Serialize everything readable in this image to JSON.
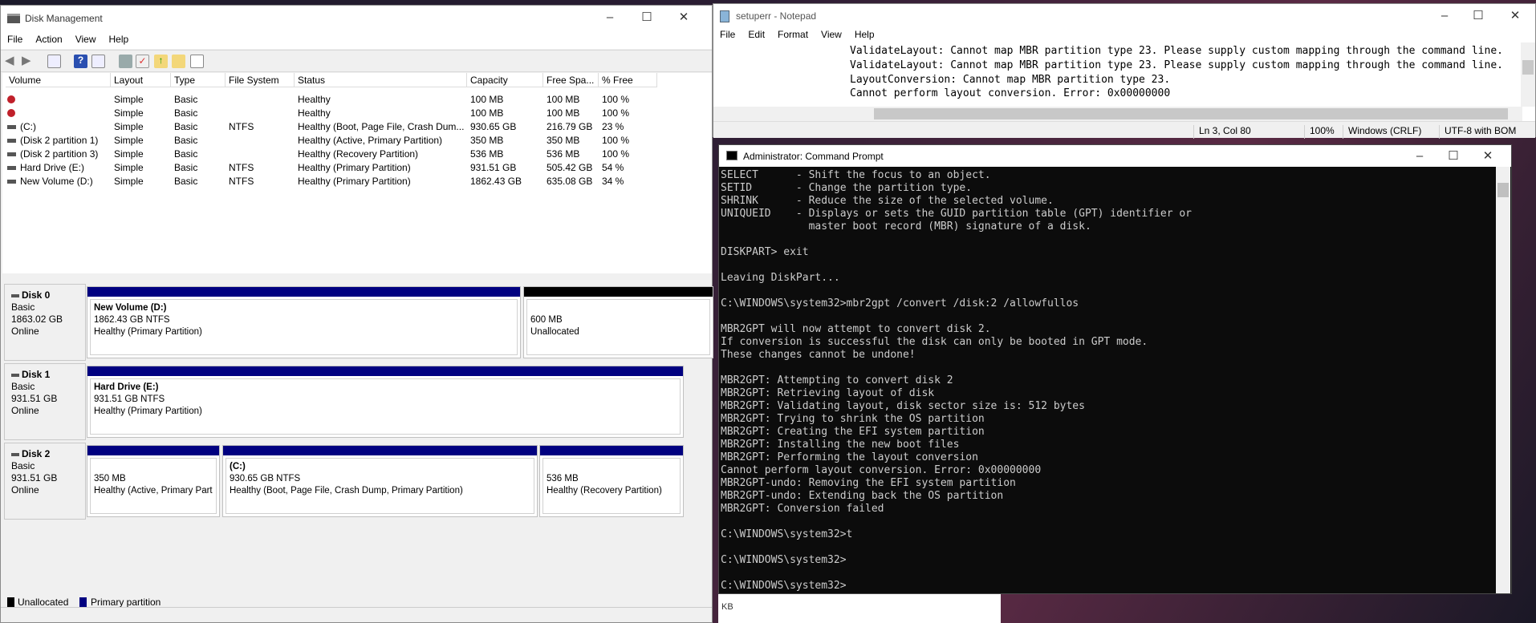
{
  "disk_mgmt": {
    "title": "Disk Management",
    "menu": [
      "File",
      "Action",
      "View",
      "Help"
    ],
    "columns": [
      "Volume",
      "Layout",
      "Type",
      "File System",
      "Status",
      "Capacity",
      "Free Spa...",
      "% Free"
    ],
    "rows": [
      {
        "icon": "error-volume-icon",
        "volume": "",
        "layout": "Simple",
        "type": "Basic",
        "fs": "",
        "status": "Healthy",
        "capacity": "100 MB",
        "free": "100 MB",
        "pct": "100 %"
      },
      {
        "icon": "error-volume-icon",
        "volume": "",
        "layout": "Simple",
        "type": "Basic",
        "fs": "",
        "status": "Healthy",
        "capacity": "100 MB",
        "free": "100 MB",
        "pct": "100 %"
      },
      {
        "icon": "drive-icon",
        "volume": "(C:)",
        "layout": "Simple",
        "type": "Basic",
        "fs": "NTFS",
        "status": "Healthy (Boot, Page File, Crash Dum...",
        "capacity": "930.65 GB",
        "free": "216.79 GB",
        "pct": "23 %"
      },
      {
        "icon": "drive-icon",
        "volume": "(Disk 2 partition 1)",
        "layout": "Simple",
        "type": "Basic",
        "fs": "",
        "status": "Healthy (Active, Primary Partition)",
        "capacity": "350 MB",
        "free": "350 MB",
        "pct": "100 %"
      },
      {
        "icon": "drive-icon",
        "volume": "(Disk 2 partition 3)",
        "layout": "Simple",
        "type": "Basic",
        "fs": "",
        "status": "Healthy (Recovery Partition)",
        "capacity": "536 MB",
        "free": "536 MB",
        "pct": "100 %"
      },
      {
        "icon": "drive-icon",
        "volume": "Hard Drive (E:)",
        "layout": "Simple",
        "type": "Basic",
        "fs": "NTFS",
        "status": "Healthy (Primary Partition)",
        "capacity": "931.51 GB",
        "free": "505.42 GB",
        "pct": "54 %"
      },
      {
        "icon": "drive-icon",
        "volume": "New Volume (D:)",
        "layout": "Simple",
        "type": "Basic",
        "fs": "NTFS",
        "status": "Healthy (Primary Partition)",
        "capacity": "1862.43 GB",
        "free": "635.08 GB",
        "pct": "34 %"
      }
    ],
    "disks": [
      {
        "name": "Disk 0",
        "type": "Basic",
        "size": "1863.02 GB",
        "state": "Online",
        "parts": [
          {
            "title": "New Volume  (D:)",
            "line1": "1862.43 GB NTFS",
            "line2": "Healthy (Primary Partition)"
          },
          {
            "title": "",
            "line1": "600 MB",
            "line2": "Unallocated"
          }
        ]
      },
      {
        "name": "Disk 1",
        "type": "Basic",
        "size": "931.51 GB",
        "state": "Online",
        "parts": [
          {
            "title": "Hard Drive  (E:)",
            "line1": "931.51 GB NTFS",
            "line2": "Healthy (Primary Partition)"
          }
        ]
      },
      {
        "name": "Disk 2",
        "type": "Basic",
        "size": "931.51 GB",
        "state": "Online",
        "parts": [
          {
            "title": "",
            "line1": "350 MB",
            "line2": "Healthy (Active, Primary Part"
          },
          {
            "title": "(C:)",
            "line1": "930.65 GB NTFS",
            "line2": "Healthy (Boot, Page File, Crash Dump, Primary Partition)"
          },
          {
            "title": "",
            "line1": "536 MB",
            "line2": "Healthy (Recovery Partition)"
          }
        ]
      }
    ],
    "legend": [
      "Unallocated",
      "Primary partition"
    ],
    "colors": {
      "primary": "#000080",
      "unallocated": "#000000"
    }
  },
  "notepad": {
    "title": "setuperr - Notepad",
    "menu": [
      "File",
      "Edit",
      "Format",
      "View",
      "Help"
    ],
    "lines": [
      "ValidateLayout: Cannot map MBR partition type 23. Please supply custom mapping through the command line.",
      "ValidateLayout: Cannot map MBR partition type 23. Please supply custom mapping through the command line.",
      "LayoutConversion: Cannot map MBR partition type 23.",
      "Cannot perform layout conversion. Error: 0x00000000"
    ],
    "status": {
      "position": "Ln 3, Col 80",
      "zoom": "100%",
      "eol": "Windows (CRLF)",
      "encoding": "UTF-8 with BOM"
    }
  },
  "cmd": {
    "title": "Administrator: Command Prompt",
    "lines": [
      "SELECT      - Shift the focus to an object.",
      "SETID       - Change the partition type.",
      "SHRINK      - Reduce the size of the selected volume.",
      "UNIQUEID    - Displays or sets the GUID partition table (GPT) identifier or",
      "              master boot record (MBR) signature of a disk.",
      "",
      "DISKPART> exit",
      "",
      "Leaving DiskPart...",
      "",
      "C:\\WINDOWS\\system32>mbr2gpt /convert /disk:2 /allowfullos",
      "",
      "MBR2GPT will now attempt to convert disk 2.",
      "If conversion is successful the disk can only be booted in GPT mode.",
      "These changes cannot be undone!",
      "",
      "MBR2GPT: Attempting to convert disk 2",
      "MBR2GPT: Retrieving layout of disk",
      "MBR2GPT: Validating layout, disk sector size is: 512 bytes",
      "MBR2GPT: Trying to shrink the OS partition",
      "MBR2GPT: Creating the EFI system partition",
      "MBR2GPT: Installing the new boot files",
      "MBR2GPT: Performing the layout conversion",
      "Cannot perform layout conversion. Error: 0x00000000",
      "MBR2GPT-undo: Removing the EFI system partition",
      "MBR2GPT-undo: Extending back the OS partition",
      "MBR2GPT: Conversion failed",
      "",
      "C:\\WINDOWS\\system32>t",
      "",
      "C:\\WINDOWS\\system32>",
      "",
      "C:\\WINDOWS\\system32>"
    ]
  },
  "background_window": {
    "text": "KB"
  }
}
